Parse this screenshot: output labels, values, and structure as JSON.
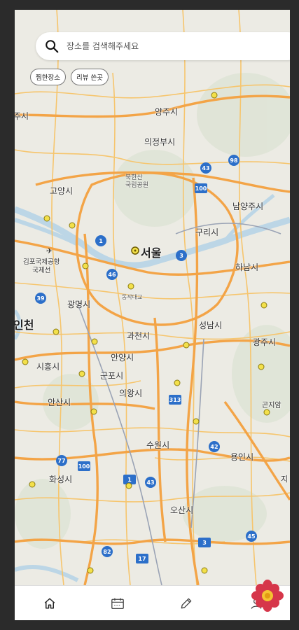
{
  "search": {
    "placeholder": "장소를 검색해주세요"
  },
  "chips": [
    {
      "label": "찜한장소"
    },
    {
      "label": "리뷰 쓴곳"
    }
  ],
  "map": {
    "place_labels": {
      "yangju": "양주시",
      "uijeongbu": "의정부시",
      "goyang": "고양시",
      "bukhansan": "북한산\n국립공원",
      "namyangju": "남양주시",
      "guri": "구리시",
      "seoul": "서울",
      "gimpo_airport": "김포국제공항\n국제선",
      "hanam": "하남시",
      "gwangmyeong": "광명시",
      "dongjak": "동작대교",
      "incheon": "인천",
      "gwacheon": "과천시",
      "seongnam": "성남시",
      "gwangju": "광주시",
      "siheung": "시흥시",
      "anyang": "안양시",
      "gunpo": "군포시",
      "uiwang": "의왕시",
      "ansan": "안산시",
      "suwon": "수원시",
      "yongin": "용인시",
      "hwaseong": "화성시",
      "osan": "오산시",
      "gonjiam": "곤지암",
      "jugsi": "주시",
      "ji": "지"
    },
    "route_shields": [
      "1",
      "3",
      "46",
      "100",
      "43",
      "98",
      "39",
      "42",
      "17",
      "77",
      "82",
      "45",
      "313",
      "100",
      "3",
      "43",
      "1"
    ]
  },
  "nav": {
    "items": [
      {
        "icon": "home-icon"
      },
      {
        "icon": "calendar-icon"
      },
      {
        "icon": "pencil-icon"
      },
      {
        "icon": "profile-icon"
      }
    ]
  },
  "colors": {
    "highway": "#f3a447",
    "road": "#f6c56d",
    "water": "#bcd6e6",
    "land": "#eceae3",
    "shield_blue": "#2c6fc9",
    "logo_red": "#d6364a"
  }
}
